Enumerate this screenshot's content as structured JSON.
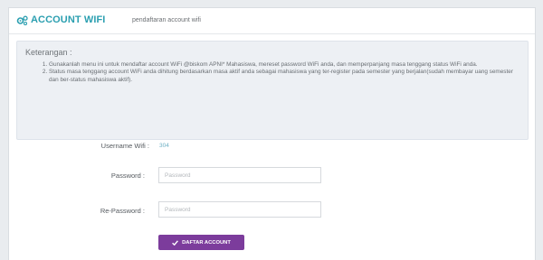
{
  "header": {
    "title": "ACCOUNT WIFI",
    "subtitle": "pendaftaran account wifi",
    "icon": "cogs-icon",
    "accent_color": "#2b9fb0"
  },
  "keterangan": {
    "title": "Keterangan :",
    "items": [
      "Gunakanlah menu ini untuk mendaftar account WiFi @biskom APNI* Mahasiswa, mereset password WiFi anda, dan memperpanjang masa tenggang status WiFi anda.",
      "Status masa tenggang account WiFi anda dihitung berdasarkan masa aktif anda sebagai mahasiswa yang ter-register pada semester yang berjalan(sudah membayar uang semester dan ber-status mahasiswa aktif)."
    ]
  },
  "form": {
    "username_label": "Username Wifi :",
    "username_value": "304",
    "password_label": "Password :",
    "password_placeholder": "Password",
    "repassword_label": "Re-Password :",
    "repassword_placeholder": "Password",
    "submit_label": "DAFTAR ACCOUNT",
    "submit_color": "#7c3c9c"
  }
}
